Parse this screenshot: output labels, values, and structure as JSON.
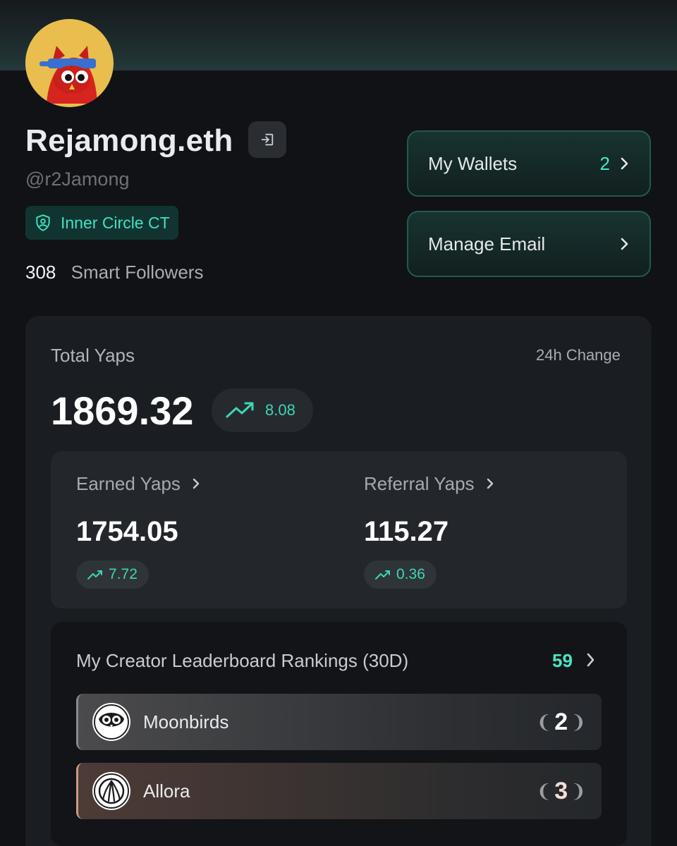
{
  "profile": {
    "name": "Rejamong.eth",
    "handle": "@r2Jamong",
    "badge": "Inner Circle CT",
    "smart_followers_count": "308",
    "smart_followers_label": "Smart Followers"
  },
  "actions": {
    "wallets": {
      "label": "My Wallets",
      "count": "2"
    },
    "email": {
      "label": "Manage Email"
    }
  },
  "yaps": {
    "total_label": "Total Yaps",
    "change_label": "24h Change",
    "total_value": "1869.32",
    "total_change": "8.08",
    "earned": {
      "label": "Earned Yaps",
      "value": "1754.05",
      "change": "7.72"
    },
    "referral": {
      "label": "Referral Yaps",
      "value": "115.27",
      "change": "0.36"
    }
  },
  "rankings": {
    "title": "My Creator Leaderboard Rankings (30D)",
    "count": "59",
    "items": [
      {
        "name": "Moonbirds",
        "rank": "2",
        "icon": "moonbirds-logo-icon"
      },
      {
        "name": "Allora",
        "rank": "3",
        "icon": "allora-logo-icon"
      }
    ]
  },
  "colors": {
    "accent": "#47e6c6",
    "background": "#101215",
    "card": "#1a1d21"
  }
}
